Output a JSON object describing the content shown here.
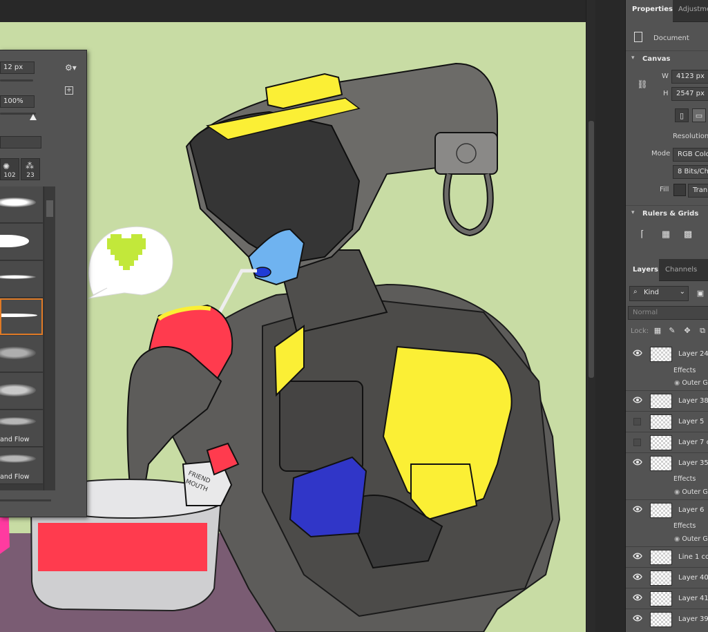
{
  "brush_panel": {
    "size_value": "12 px",
    "hardness_value": "100%",
    "tip_counts": [
      "102",
      "23"
    ],
    "presets": [
      {
        "label": ""
      },
      {
        "label": ""
      },
      {
        "label": ""
      },
      {
        "label": ""
      },
      {
        "label": ""
      },
      {
        "label": ""
      },
      {
        "label": "and Flow"
      },
      {
        "label": "and Flow"
      }
    ]
  },
  "art": {
    "bottle_label": "FRIEND\nMOUTH",
    "colors": {
      "background": "#c8dca4",
      "yellow": "#fbef35",
      "red": "#ff3b4e",
      "blue": "#3036c8",
      "heart": "#c2e83a",
      "table": "#7a5c73"
    }
  },
  "properties": {
    "tabs": [
      "Properties",
      "Adjustme"
    ],
    "document_label": "Document",
    "canvas_section": "Canvas",
    "w_label": "W",
    "w_value": "4123 px",
    "h_label": "H",
    "h_value": "2547 px",
    "resolution_label": "Resolution:",
    "mode_label": "Mode",
    "mode_value": "RGB Colo",
    "bits_value": "8 Bits/Cha",
    "fill_label": "Fill",
    "fill_value": "Tran",
    "rulers_section": "Rulers & Grids"
  },
  "layers_panel": {
    "tabs": [
      "Layers",
      "Channels"
    ],
    "filter_kind": "Kind",
    "blend_mode": "Normal",
    "lock_label": "Lock:",
    "layers": [
      {
        "name": "Layer 24",
        "visible": true,
        "effects": "Effects",
        "effect_item": "Outer G"
      },
      {
        "name": "Layer 38",
        "visible": true
      },
      {
        "name": "Layer 5",
        "visible": false
      },
      {
        "name": "Layer 7 co",
        "visible": false
      },
      {
        "name": "Layer 35",
        "visible": true,
        "effects": "Effects",
        "effect_item": "Outer G"
      },
      {
        "name": "Layer 6",
        "visible": true,
        "effects": "Effects",
        "effect_item": "Outer G"
      },
      {
        "name": "Line 1 cop",
        "visible": true
      },
      {
        "name": "Layer 40",
        "visible": true
      },
      {
        "name": "Layer 41",
        "visible": true
      },
      {
        "name": "Layer 39",
        "visible": true
      }
    ]
  }
}
